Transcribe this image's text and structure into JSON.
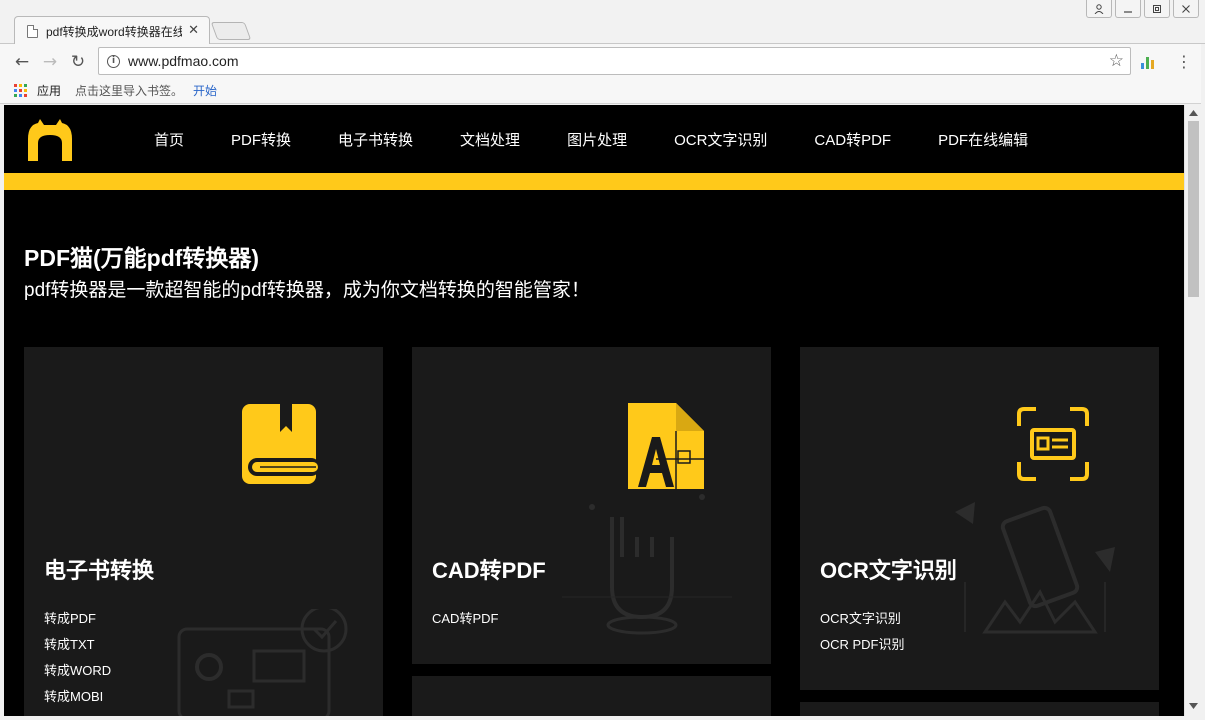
{
  "browser": {
    "tab_title": "pdf转换成word转换器在线",
    "tab_close": "✕",
    "url": "www.pdfmao.com",
    "back": "←",
    "forward": "→",
    "reload": "↻",
    "star": "☆",
    "menu": "⋮",
    "info": "i",
    "window_user": "👤",
    "window_minimize": "—",
    "window_restore": "❐",
    "window_close": "✕"
  },
  "bookmarks": {
    "apps_label": "应用",
    "hint": "点击这里导入书签。",
    "start_link": "开始"
  },
  "site": {
    "nav": [
      {
        "label": "首页"
      },
      {
        "label": "PDF转换"
      },
      {
        "label": "电子书转换"
      },
      {
        "label": "文档处理"
      },
      {
        "label": "图片处理"
      },
      {
        "label": "OCR文字识别"
      },
      {
        "label": "CAD转PDF"
      },
      {
        "label": "PDF在线编辑"
      }
    ],
    "hero_title": "PDF猫(万能pdf转换器)",
    "hero_subtitle": "pdf转换器是一款超智能的pdf转换器，成为你文档转换的智能管家！",
    "cards": [
      {
        "title": "电子书转换",
        "icon": "book-icon",
        "links": [
          "转成PDF",
          "转成TXT",
          "转成WORD",
          "转成MOBI"
        ]
      },
      {
        "title": "CAD转PDF",
        "icon": "cad-file-icon",
        "links": [
          "CAD转PDF"
        ]
      },
      {
        "title": "OCR文字识别",
        "icon": "scan-id-icon",
        "links": [
          "OCR文字识别",
          "OCR PDF识别"
        ]
      }
    ]
  },
  "colors": {
    "accent": "#ffc91a",
    "page_bg": "#000000",
    "card_bg": "#1a1a1a"
  }
}
